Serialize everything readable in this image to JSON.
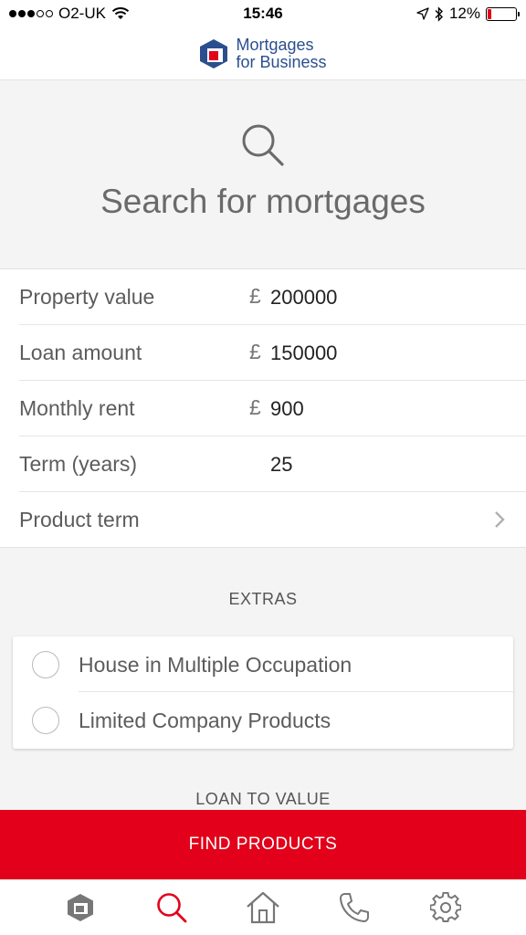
{
  "status_bar": {
    "carrier": "O2-UK",
    "time": "15:46",
    "battery": "12%",
    "battery_level": 0.12
  },
  "header": {
    "logo_line1": "Mortgages",
    "logo_line2": "for Business"
  },
  "hero": {
    "icon": "search-icon",
    "title": "Search for mortgages"
  },
  "form": {
    "rows": [
      {
        "label": "Property value",
        "currency": "£",
        "value": "200000"
      },
      {
        "label": "Loan amount",
        "currency": "£",
        "value": "150000"
      },
      {
        "label": "Monthly rent",
        "currency": "£",
        "value": "900"
      },
      {
        "label": "Term (years)",
        "currency": "",
        "value": "25"
      },
      {
        "label": "Product term",
        "currency": "",
        "value": ""
      }
    ]
  },
  "extras": {
    "title": "EXTRAS",
    "options": [
      {
        "label": "House in Multiple Occupation",
        "selected": false
      },
      {
        "label": "Limited Company Products",
        "selected": false
      }
    ]
  },
  "ltv": {
    "title": "LOAN TO VALUE"
  },
  "actions": {
    "find_label": "FIND PRODUCTS"
  },
  "tab_bar": {
    "tabs": [
      {
        "icon": "logo-icon",
        "active": false
      },
      {
        "icon": "search-icon",
        "active": true
      },
      {
        "icon": "home-icon",
        "active": false
      },
      {
        "icon": "phone-icon",
        "active": false
      },
      {
        "icon": "gear-icon",
        "active": false
      }
    ]
  },
  "colors": {
    "accent": "#e2001a",
    "brand": "#2b4f8e",
    "background": "#f4f4f4"
  }
}
